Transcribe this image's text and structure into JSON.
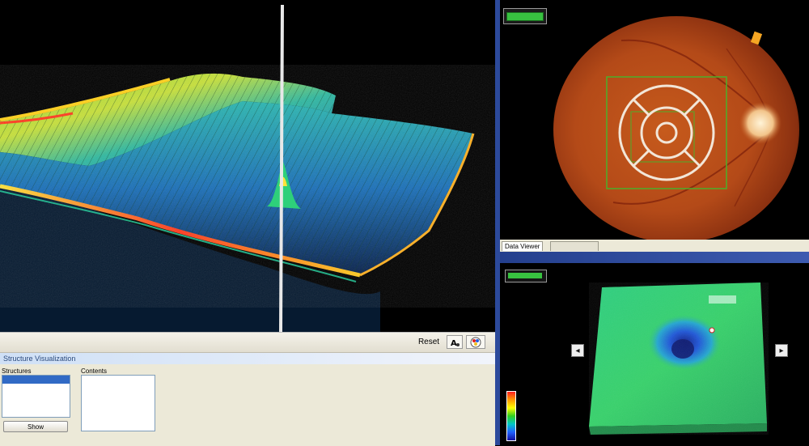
{
  "viewer": {
    "main_panel": "3D OCT volume rendering",
    "toolbar": {
      "reset_label": "Reset"
    },
    "bottom_panel": {
      "title": "Structure  Visualization",
      "structures_label": "Structures",
      "structures": [
        "",
        "",
        ""
      ],
      "contents_label": "Contents",
      "contents": [
        "",
        "",
        "",
        "",
        ""
      ],
      "show_button": "Show"
    }
  },
  "fundus": {
    "grid_values": {
      "center": "",
      "inner_top": "",
      "inner_bottom": "",
      "inner_left": "",
      "inner_right": "",
      "outer_top": "",
      "outer_bottom": "",
      "outer_left": "",
      "outer_right": ""
    }
  },
  "tabs": [
    {
      "label": "Data Viewer",
      "active": true
    },
    {
      "label": "",
      "active": false
    }
  ],
  "thickness_map": {
    "title": "",
    "annotation": "",
    "colorbar_ticks": [
      "",
      "",
      "",
      "",
      "",
      "",
      ""
    ]
  },
  "colors": {
    "accent_blue": "#2c4a9c",
    "tag_green": "#38c140",
    "grid_line": "#f2e6d8",
    "selection": "#316ac5"
  }
}
